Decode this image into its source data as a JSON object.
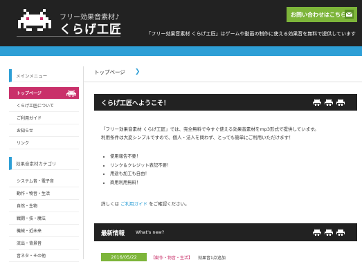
{
  "header": {
    "logo_subtitle": "フリー効果音素材♪",
    "logo_title": "くらげ工匠",
    "contact_label": "お問い合わせはこちら",
    "tagline": "「フリー効果音素材 くらげ工匠」はゲームや動画の制作に使える効果音を無料で提供しています"
  },
  "colors": {
    "accent_blue": "#2e9fd6",
    "active_pink": "#c9306a",
    "button_green": "#7db53a",
    "dark": "#222222"
  },
  "sidebar": {
    "menu_heading": "メインメニュー",
    "menu_items": [
      {
        "label": "トップページ",
        "active": true
      },
      {
        "label": "くらげ工匠について"
      },
      {
        "label": "ご利用ガイド"
      },
      {
        "label": "お知らせ"
      },
      {
        "label": "リンク"
      }
    ],
    "category_heading": "効果音素材カテゴリ",
    "category_items": [
      {
        "label": "システム音・電子音"
      },
      {
        "label": "動作・物音・生活"
      },
      {
        "label": "自然・生物"
      },
      {
        "label": "戦闘・技・魔法"
      },
      {
        "label": "機械・近未来"
      },
      {
        "label": "流出・背景音"
      },
      {
        "label": "音ネタ・その他"
      }
    ]
  },
  "breadcrumb": {
    "current": "トップページ",
    "arrow": "❯"
  },
  "welcome": {
    "title": "くらげ工匠へようこそ！",
    "intro_line1": "「フリー効果音素材 くらげ工匠」では、完全無料で今すぐ使える効果音素材をmp3形式で提供しています。",
    "intro_line2": "利用条件は大変シンプルですので、個人・法人を問わず、とっても簡単にご利用いただけます！",
    "bullets": [
      "使用報告不要！",
      "リンク＆クレジット表記不要！",
      "用途も加工も自由！",
      "商用利用無料！"
    ],
    "details_prefix": "詳しくは ",
    "details_link": "ご利用ガイド",
    "details_suffix": " をご確認ください。"
  },
  "news": {
    "title": "最新情報",
    "subtitle": "What's new?",
    "items": [
      {
        "date": "2016/05/22",
        "category": "【動作・物音・生活】",
        "text": "効果音1点追加"
      }
    ]
  }
}
